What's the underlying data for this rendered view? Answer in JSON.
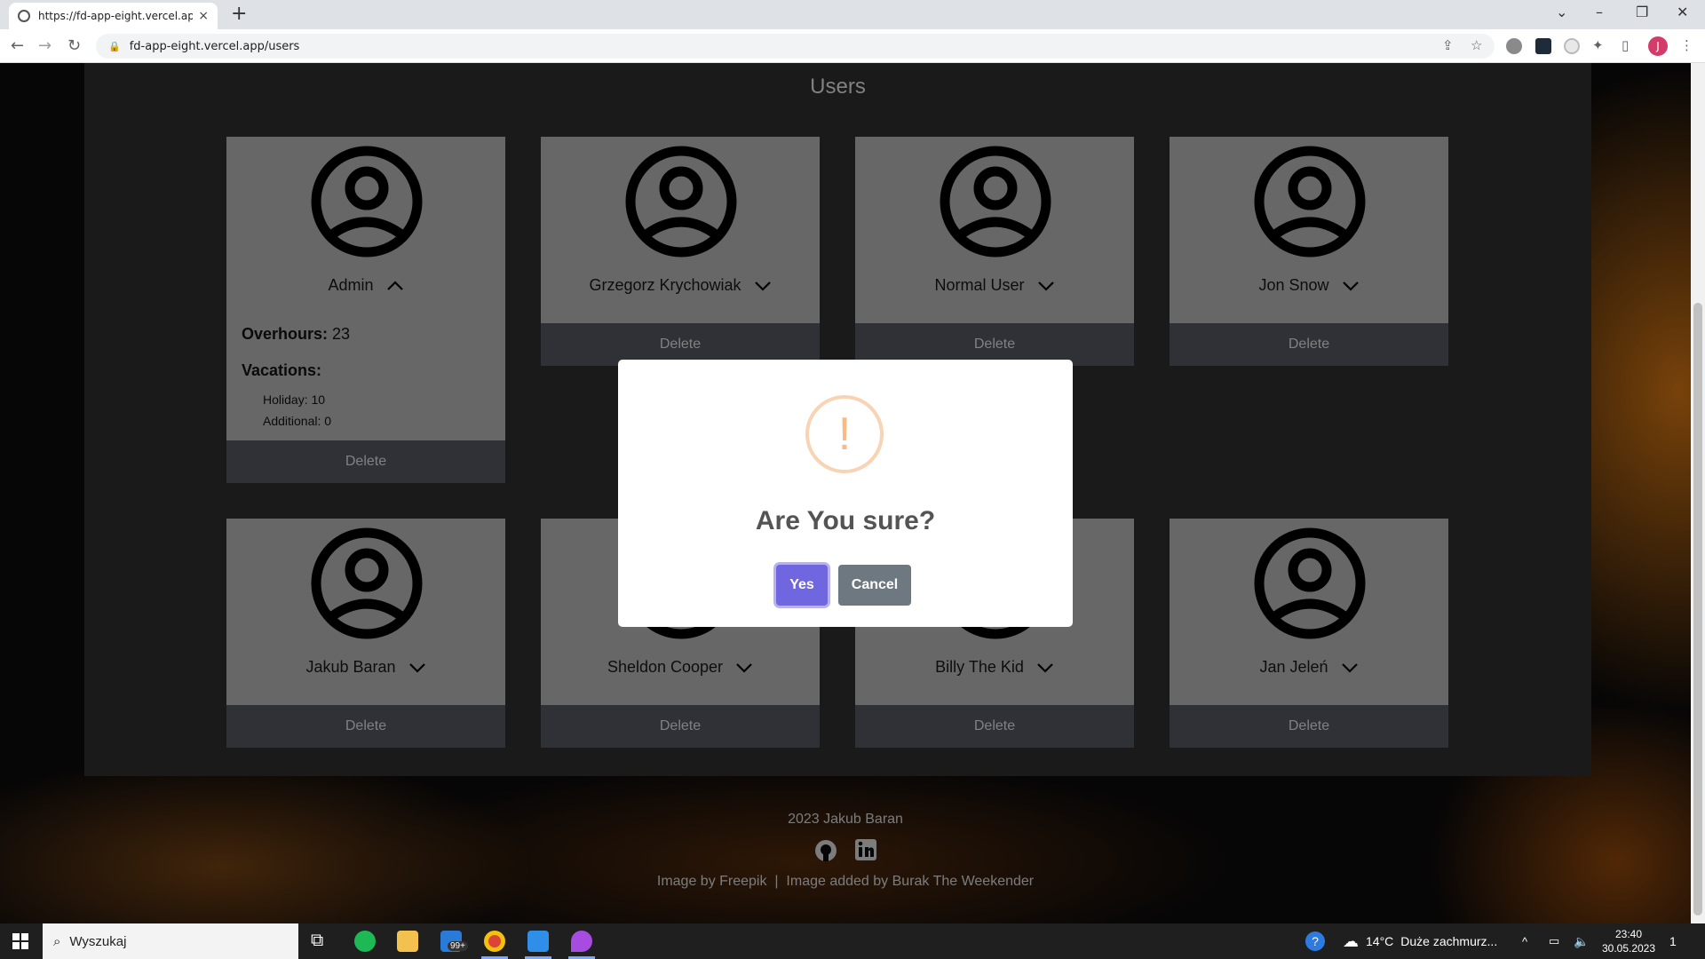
{
  "browser": {
    "tab_title": "https://fd-app-eight.vercel.app/u",
    "tab_close": "×",
    "new_tab": "+",
    "url": "fd-app-eight.vercel.app/users",
    "profile_initial": "J"
  },
  "page": {
    "title": "Users",
    "delete_label": "Delete",
    "users": [
      {
        "name": "Admin",
        "expanded": true
      },
      {
        "name": "Grzegorz Krychowiak",
        "expanded": false
      },
      {
        "name": "Normal User",
        "expanded": false
      },
      {
        "name": "Jon Snow",
        "expanded": false
      },
      {
        "name": "Jakub Baran",
        "expanded": false
      },
      {
        "name": "Sheldon Cooper",
        "expanded": false
      },
      {
        "name": "Billy The Kid",
        "expanded": false
      },
      {
        "name": "Jan Jeleń",
        "expanded": false
      }
    ],
    "admin_details": {
      "overhours_label": "Overhours:",
      "overhours_value": "23",
      "vacations_label": "Vacations:",
      "holiday": "Holiday: 10",
      "additional": "Additional: 0"
    }
  },
  "footer": {
    "copyright": "2023 Jakub Baran",
    "credits": "Image by Freepik  |  Image added by Burak The Weekender",
    "icons": [
      "github-icon",
      "linkedin-icon"
    ]
  },
  "modal": {
    "icon_symbol": "!",
    "question": "Are You sure?",
    "yes_label": "Yes",
    "cancel_label": "Cancel",
    "colors": {
      "yes": "#7066e0",
      "cancel": "#6e7881",
      "warning": "#f8bb86"
    }
  },
  "taskbar": {
    "search_placeholder": "Wyszukaj",
    "mail_badge": "99+",
    "weather_temp": "14°C",
    "weather_text": "Duże zachmurz...",
    "time": "23:40",
    "date": "30.05.2023",
    "notification_count": "1"
  }
}
